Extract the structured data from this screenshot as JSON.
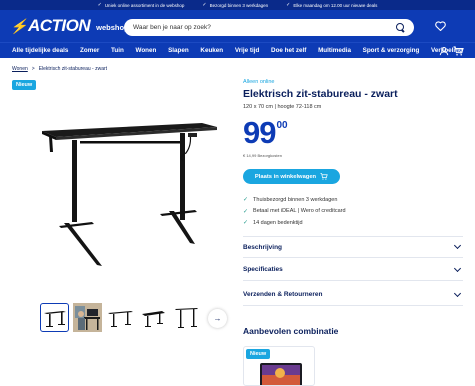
{
  "topbar": {
    "usps": [
      "Uniek online assortiment in de webshop",
      "Bezorgd binnen 3 werkdagen",
      "Elke maandag om 12.00 uur nieuwe deals"
    ]
  },
  "header": {
    "logo_text": "ACTION",
    "logo_sub": "webshop",
    "search_placeholder": "Waar ben je naar op zoek?",
    "icons": [
      "heart-icon",
      "user-icon",
      "cart-icon"
    ]
  },
  "nav": {
    "items": [
      "Alle tijdelijke deals",
      "Zomer",
      "Tuin",
      "Wonen",
      "Slapen",
      "Keuken",
      "Vrije tijd",
      "Doe het zelf",
      "Multimedia",
      "Sport & verzorging",
      "Verkoeling"
    ]
  },
  "breadcrumb": {
    "items": [
      "Wonen",
      "Elektrisch zit-stabureau - zwart"
    ],
    "separator": ">"
  },
  "gallery": {
    "badge": "Nieuw",
    "thumbnail_count": 5
  },
  "product": {
    "availability": "Alleen online",
    "title": "Elektrisch zit-stabureau - zwart",
    "dimensions": "120 x 70 cm | hoogte 72-118 cm",
    "price_whole": "99",
    "price_cents": "00",
    "unit_price": "€ 14,99 Bezorgkosten",
    "cart_button": "Plaats in winkelwagen",
    "usps": [
      "Thuisbezorgd binnen 3 werkdagen",
      "Betaal met iDEAL | Wero of creditcard",
      "14 dagen bedenktijd"
    ]
  },
  "accordions": [
    "Beschrijving",
    "Specificaties",
    "Verzenden & Retourneren"
  ],
  "recommended": {
    "title": "Aanbevolen combinatie",
    "badge": "Nieuw"
  },
  "colors": {
    "brand_blue": "#0d3bb5",
    "dark_blue": "#0a2a8a",
    "accent_cyan": "#1aa6e0",
    "text_navy": "#0a1f5c",
    "check_green": "#2a9d8f"
  }
}
